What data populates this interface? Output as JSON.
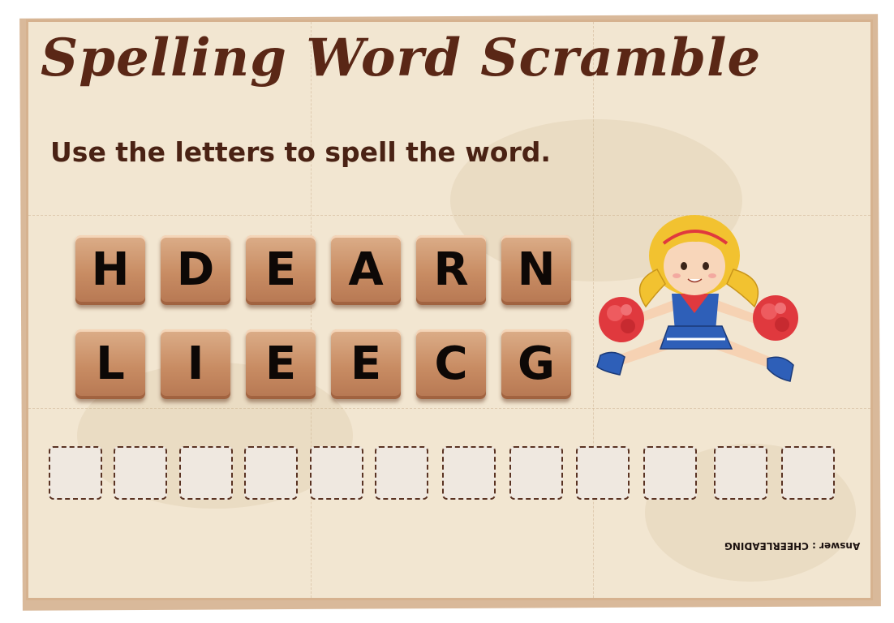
{
  "title": "Spelling Word Scramble",
  "instruction": "Use the letters to spell the word.",
  "tiles_row1": [
    "H",
    "D",
    "E",
    "A",
    "R",
    "N"
  ],
  "tiles_row2": [
    "L",
    "I",
    "E",
    "E",
    "C",
    "G"
  ],
  "answer_slot_count": 12,
  "answer_text": "Answer : CHEERLEADING",
  "illustration": "cheerleader-with-pompoms",
  "colors": {
    "background": "#f2e6d1",
    "title": "#5a2716",
    "tile": "#c88c63",
    "pompom": "#e0393e",
    "uniform": "#1f4fa3"
  }
}
